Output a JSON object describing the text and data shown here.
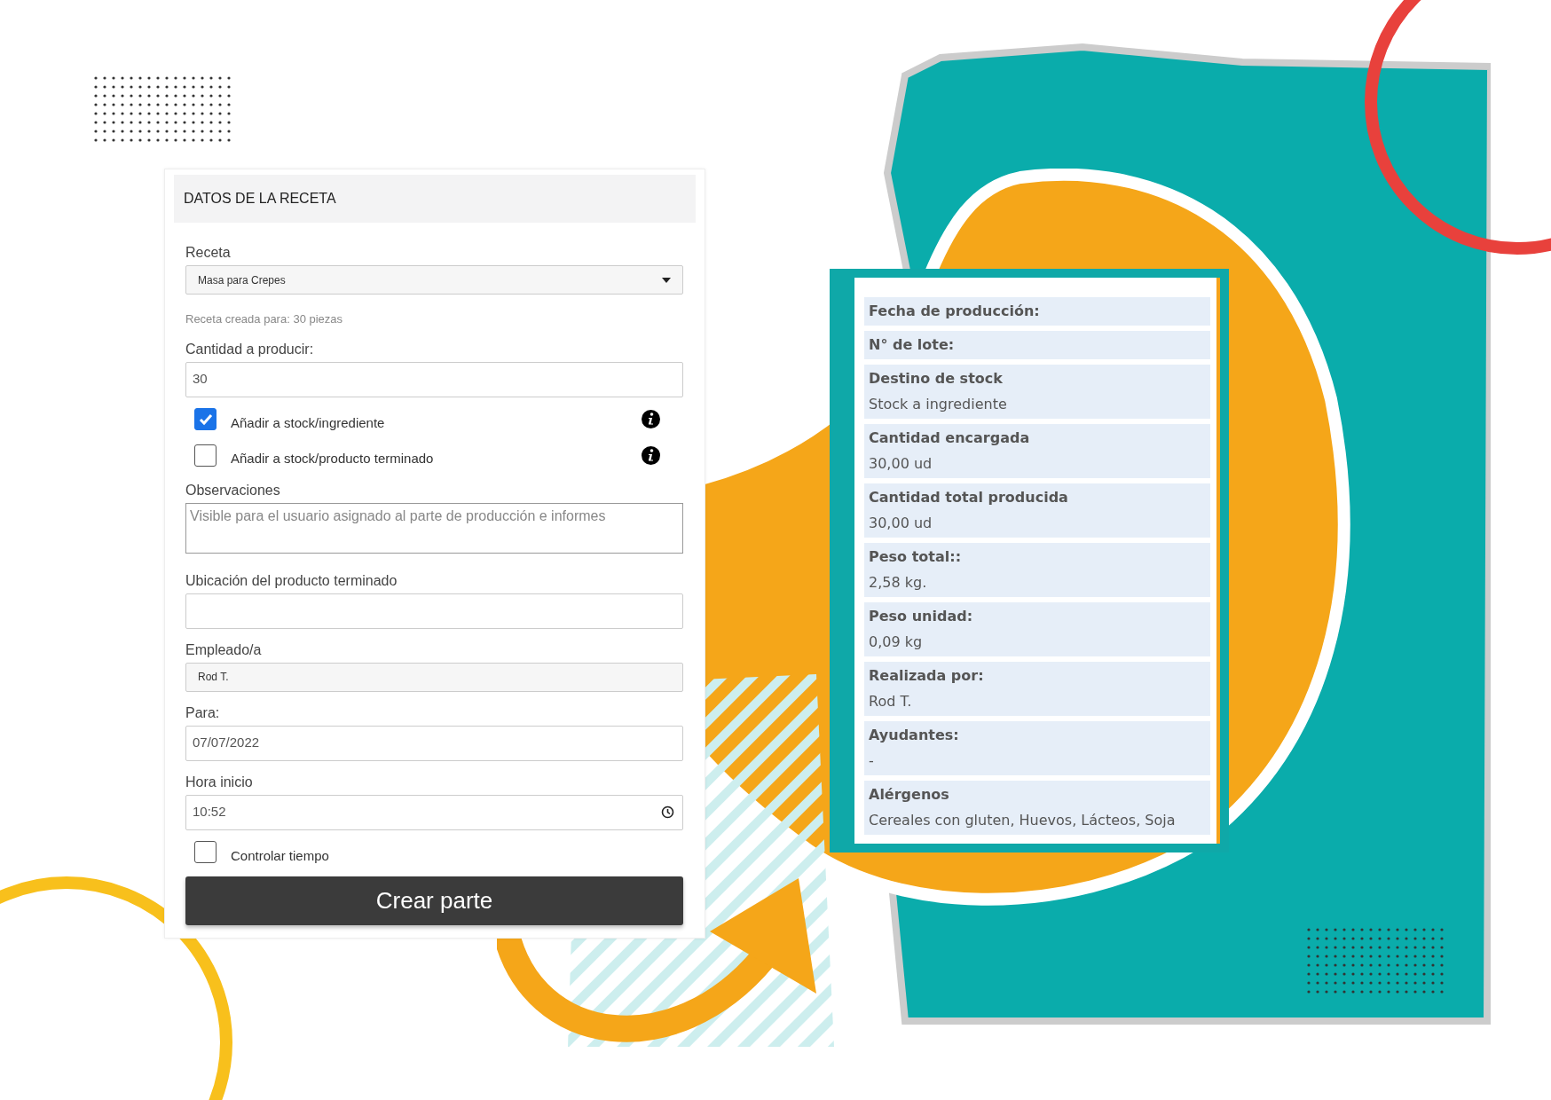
{
  "form": {
    "title": "DATOS DE LA RECETA",
    "items": [
      {
        "kind": "select",
        "label": "Receta",
        "value": "Masa para Crepes"
      },
      {
        "kind": "note",
        "text": "Receta creada para: 30 piezas"
      },
      {
        "kind": "text",
        "label": "Cantidad a producir:",
        "value": "30"
      },
      {
        "kind": "checkbox",
        "label": "Añadir a stock/ingrediente",
        "checked": true,
        "info": true
      },
      {
        "kind": "checkbox",
        "label": "Añadir a stock/producto terminado",
        "checked": false,
        "info": true
      },
      {
        "kind": "textarea",
        "label": "Observaciones",
        "placeholder": "Visible para el usuario asignado al parte de producción e informes"
      },
      {
        "kind": "text",
        "label": "Ubicación del producto terminado"
      },
      {
        "kind": "readonly",
        "label": "Empleado/a",
        "value": "Rod T."
      },
      {
        "kind": "text",
        "label": "Para:",
        "value": "07/07/2022"
      },
      {
        "kind": "time",
        "label": "Hora inicio",
        "value": "10:52"
      },
      {
        "kind": "checkbox",
        "label": "Controlar tiempo",
        "checked": false,
        "info": false
      },
      {
        "kind": "button",
        "label": "Crear parte"
      }
    ]
  },
  "summary": {
    "rows": [
      {
        "label": "Fecha de producción:"
      },
      {
        "label": "N° de lote:"
      },
      {
        "label": "Destino de stock",
        "value": "Stock a ingrediente"
      },
      {
        "label": "Cantidad encargada",
        "value": "30,00 ud"
      },
      {
        "label": "Cantidad total producida",
        "value": "30,00 ud"
      },
      {
        "label": "Peso total::",
        "value": "2,58 kg."
      },
      {
        "label": "Peso unidad:",
        "value": "0,09 kg"
      },
      {
        "label": "Realizada por:",
        "value": "Rod T."
      },
      {
        "label": "Ayudantes:",
        "value": "-"
      },
      {
        "label": "Alérgenos",
        "value": "Cereales con gluten, Huevos, Lácteos, Soja"
      }
    ]
  }
}
